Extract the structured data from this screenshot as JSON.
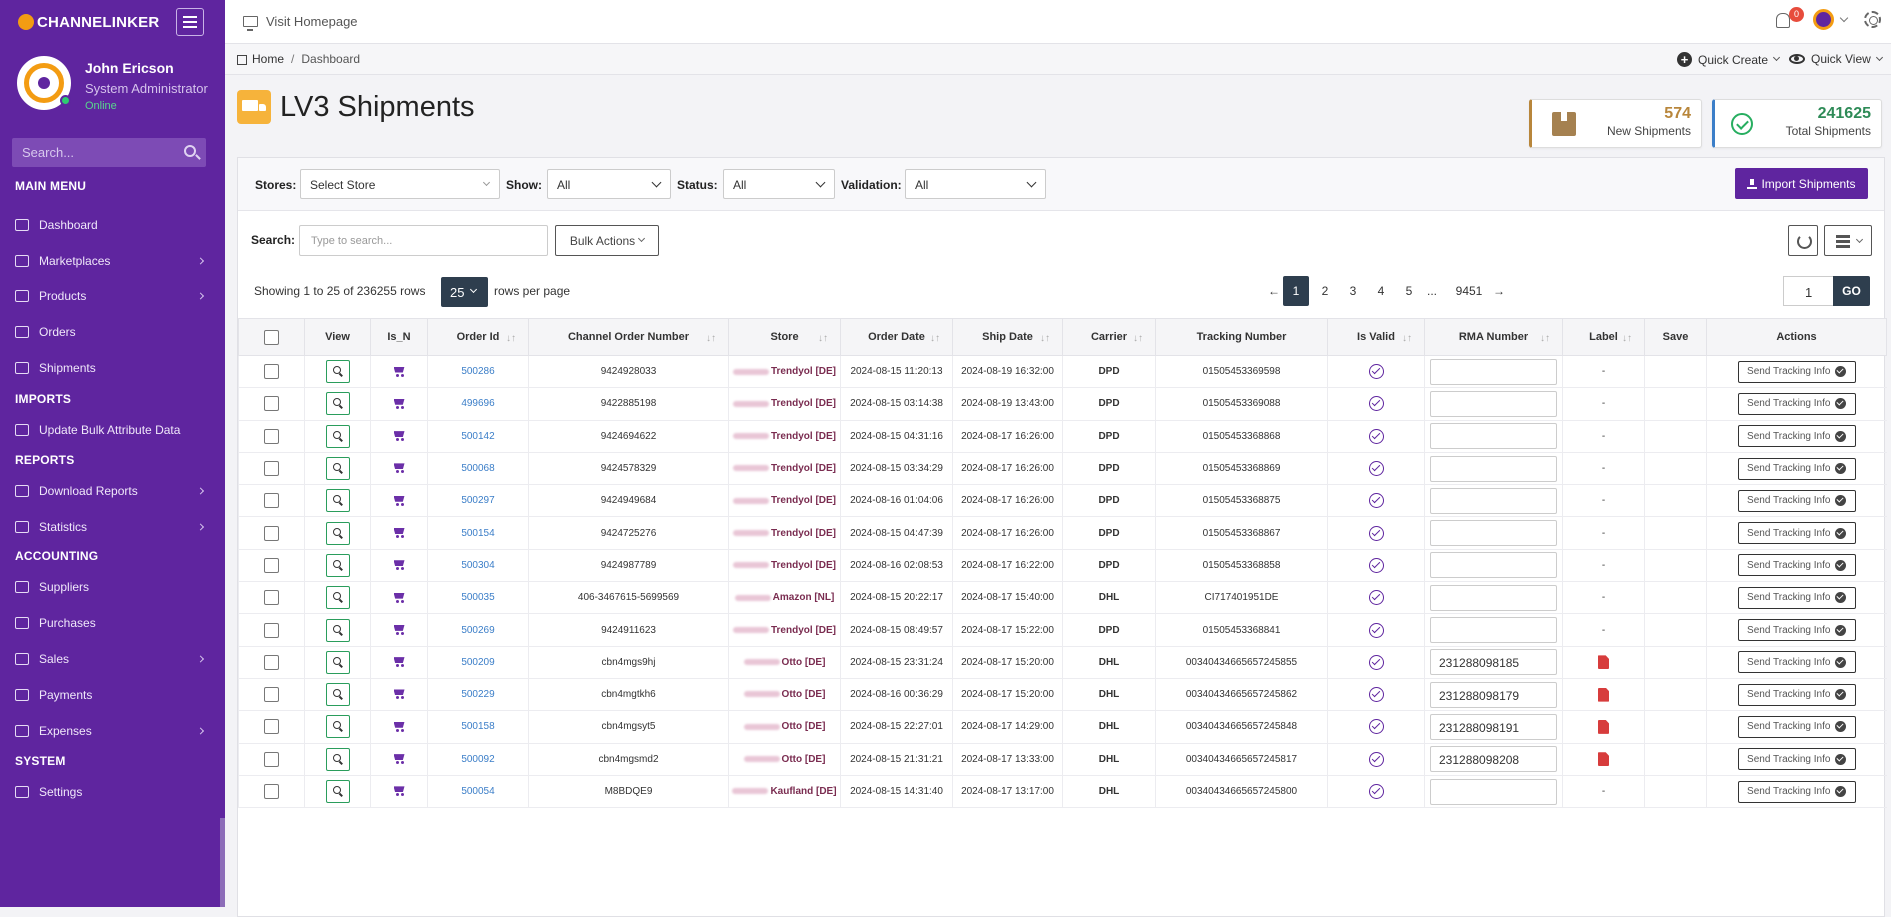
{
  "brand": "CHANNELINKER",
  "user": {
    "name": "John Ericson",
    "role": "System Administrator",
    "status": "Online"
  },
  "sidebar_search_placeholder": "Search...",
  "menu": {
    "main_title": "MAIN MENU",
    "main_items": [
      {
        "label": "Dashboard",
        "icon": "dashboard-icon"
      },
      {
        "label": "Marketplaces",
        "icon": "bag-icon"
      },
      {
        "label": "Products",
        "icon": "tag-icon"
      },
      {
        "label": "Orders",
        "icon": "cart-icon"
      },
      {
        "label": "Shipments",
        "icon": "box-icon"
      }
    ],
    "imports_title": "IMPORTS",
    "imports_items": [
      {
        "label": "Update Bulk Attribute Data",
        "icon": "cloud-upload-icon"
      }
    ],
    "reports_title": "REPORTS",
    "reports_items": [
      {
        "label": "Download Reports",
        "icon": "cloud-download-icon"
      },
      {
        "label": "Statistics",
        "icon": "bar-chart-icon"
      }
    ],
    "accounting_title": "ACCOUNTING",
    "accounting_items": [
      {
        "label": "Suppliers",
        "icon": "briefcase-icon"
      },
      {
        "label": "Purchases",
        "icon": "document-icon"
      },
      {
        "label": "Sales",
        "icon": "clipboard-icon"
      },
      {
        "label": "Payments",
        "icon": "wallet-icon"
      },
      {
        "label": "Expenses",
        "icon": "folder-icon"
      }
    ],
    "system_title": "SYSTEM",
    "system_items": [
      {
        "label": "Settings",
        "icon": "gear-icon"
      }
    ]
  },
  "topbar": {
    "visit": "Visit Homepage",
    "notifications": "0"
  },
  "breadcrumb": {
    "home": "Home",
    "current": "Dashboard"
  },
  "quick_create": "Quick Create",
  "quick_view": "Quick View",
  "page_title": "LV3 Shipments",
  "stats": {
    "new": {
      "value": "574",
      "label": "New Shipments",
      "color": "#b8863b"
    },
    "total": {
      "value": "241625",
      "label": "Total Shipments",
      "color": "#2e8b57"
    }
  },
  "filters": {
    "stores_label": "Stores:",
    "stores_value": "Select Store",
    "show_label": "Show:",
    "show_value": "All",
    "status_label": "Status:",
    "status_value": "All",
    "validation_label": "Validation:",
    "validation_value": "All",
    "import_button": "Import Shipments"
  },
  "search": {
    "label": "Search:",
    "placeholder": "Type to search...",
    "bulk": "Bulk Actions"
  },
  "listing": {
    "showing": "Showing 1 to 25 of 236255 rows",
    "per_page": "25",
    "per_page_label": "rows per page"
  },
  "pagination": {
    "prev": "←",
    "pages": [
      "1",
      "2",
      "3",
      "4",
      "5",
      "...",
      "9451"
    ],
    "next": "→",
    "goto_value": "1",
    "go": "GO"
  },
  "columns": [
    "View",
    "Is_N",
    "Order Id",
    "Channel Order Number",
    "Store",
    "Order Date",
    "Ship Date",
    "Carrier",
    "Tracking Number",
    "Is Valid",
    "RMA Number",
    "Label",
    "Save",
    "Actions"
  ],
  "action_label": "Send Tracking Info",
  "rows": [
    {
      "order_id": "500286",
      "channel": "9424928033",
      "store": "Trendyol [DE]",
      "order_date": "2024-08-15 11:20:13",
      "ship_date": "2024-08-19 16:32:00",
      "carrier": "DPD",
      "tracking": "01505453369598",
      "rma": "",
      "label": "-"
    },
    {
      "order_id": "499696",
      "channel": "9422885198",
      "store": "Trendyol [DE]",
      "order_date": "2024-08-15 03:14:38",
      "ship_date": "2024-08-19 13:43:00",
      "carrier": "DPD",
      "tracking": "01505453369088",
      "rma": "",
      "label": "-"
    },
    {
      "order_id": "500142",
      "channel": "9424694622",
      "store": "Trendyol [DE]",
      "order_date": "2024-08-15 04:31:16",
      "ship_date": "2024-08-17 16:26:00",
      "carrier": "DPD",
      "tracking": "01505453368868",
      "rma": "",
      "label": "-"
    },
    {
      "order_id": "500068",
      "channel": "9424578329",
      "store": "Trendyol [DE]",
      "order_date": "2024-08-15 03:34:29",
      "ship_date": "2024-08-17 16:26:00",
      "carrier": "DPD",
      "tracking": "01505453368869",
      "rma": "",
      "label": "-"
    },
    {
      "order_id": "500297",
      "channel": "9424949684",
      "store": "Trendyol [DE]",
      "order_date": "2024-08-16 01:04:06",
      "ship_date": "2024-08-17 16:26:00",
      "carrier": "DPD",
      "tracking": "01505453368875",
      "rma": "",
      "label": "-"
    },
    {
      "order_id": "500154",
      "channel": "9424725276",
      "store": "Trendyol [DE]",
      "order_date": "2024-08-15 04:47:39",
      "ship_date": "2024-08-17 16:26:00",
      "carrier": "DPD",
      "tracking": "01505453368867",
      "rma": "",
      "label": "-"
    },
    {
      "order_id": "500304",
      "channel": "9424987789",
      "store": "Trendyol [DE]",
      "order_date": "2024-08-16 02:08:53",
      "ship_date": "2024-08-17 16:22:00",
      "carrier": "DPD",
      "tracking": "01505453368858",
      "rma": "",
      "label": "-"
    },
    {
      "order_id": "500035",
      "channel": "406-3467615-5699569",
      "store": "Amazon [NL]",
      "order_date": "2024-08-15 20:22:17",
      "ship_date": "2024-08-17 15:40:00",
      "carrier": "DHL",
      "tracking": "CI717401951DE",
      "rma": "",
      "label": "-"
    },
    {
      "order_id": "500269",
      "channel": "9424911623",
      "store": "Trendyol [DE]",
      "order_date": "2024-08-15 08:49:57",
      "ship_date": "2024-08-17 15:22:00",
      "carrier": "DPD",
      "tracking": "01505453368841",
      "rma": "",
      "label": "-"
    },
    {
      "order_id": "500209",
      "channel": "cbn4mgs9hj",
      "store": "Otto [DE]",
      "order_date": "2024-08-15 23:31:24",
      "ship_date": "2024-08-17 15:20:00",
      "carrier": "DHL",
      "tracking": "00340434665657245855",
      "rma": "231288098185",
      "label": "pdf"
    },
    {
      "order_id": "500229",
      "channel": "cbn4mgtkh6",
      "store": "Otto [DE]",
      "order_date": "2024-08-16 00:36:29",
      "ship_date": "2024-08-17 15:20:00",
      "carrier": "DHL",
      "tracking": "00340434665657245862",
      "rma": "231288098179",
      "label": "pdf"
    },
    {
      "order_id": "500158",
      "channel": "cbn4mgsyt5",
      "store": "Otto [DE]",
      "order_date": "2024-08-15 22:27:01",
      "ship_date": "2024-08-17 14:29:00",
      "carrier": "DHL",
      "tracking": "00340434665657245848",
      "rma": "231288098191",
      "label": "pdf"
    },
    {
      "order_id": "500092",
      "channel": "cbn4mgsmd2",
      "store": "Otto [DE]",
      "order_date": "2024-08-15 21:31:21",
      "ship_date": "2024-08-17 13:33:00",
      "carrier": "DHL",
      "tracking": "00340434665657245817",
      "rma": "231288098208",
      "label": "pdf"
    },
    {
      "order_id": "500054",
      "channel": "M8BDQE9",
      "store": "Kaufland [DE]",
      "order_date": "2024-08-15 14:31:40",
      "ship_date": "2024-08-17 13:17:00",
      "carrier": "DHL",
      "tracking": "00340434665657245800",
      "rma": "",
      "label": "-"
    }
  ]
}
